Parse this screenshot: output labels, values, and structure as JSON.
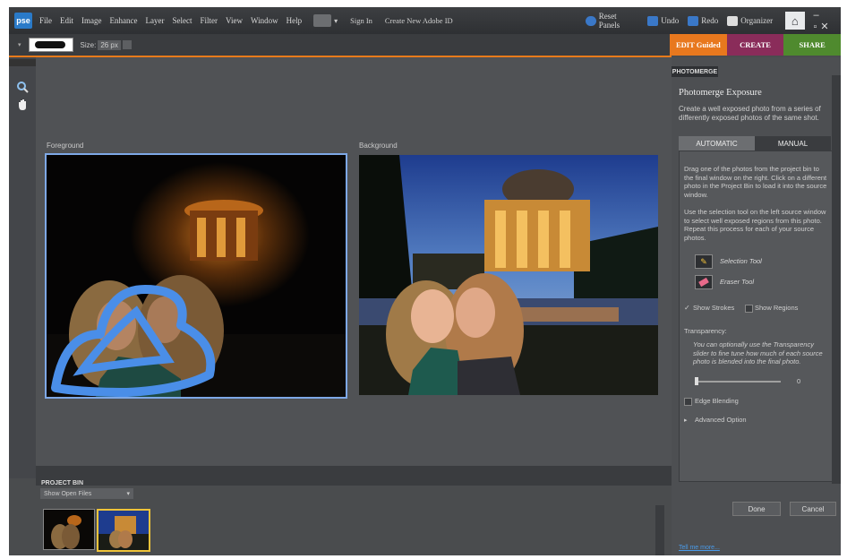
{
  "menubar": {
    "logo": "pse",
    "menus": [
      "File",
      "Edit",
      "Image",
      "Enhance",
      "Layer",
      "Select",
      "Filter",
      "View",
      "Window",
      "Help"
    ],
    "sign_in": "Sign In",
    "create_id": "Create New Adobe ID",
    "reset_panels": "Reset Panels",
    "undo": "Undo",
    "redo": "Redo",
    "organizer": "Organizer"
  },
  "options": {
    "size_label": "Size:",
    "size_value": "26 px"
  },
  "mode_tabs": [
    {
      "label": "EDIT Guided",
      "color": "#e8781e"
    },
    {
      "label": "CREATE",
      "color": "#8a2c5a"
    },
    {
      "label": "SHARE",
      "color": "#4f8a2e"
    }
  ],
  "canvas": {
    "foreground_label": "Foreground",
    "background_label": "Background"
  },
  "project_bin": {
    "title": "PROJECT BIN",
    "select_value": "Show Open Files"
  },
  "panel": {
    "tab": "PHOTOMERGE",
    "title": "Photomerge Exposure",
    "description": "Create a well exposed photo from a series of differently exposed photos of the same shot.",
    "subtab_automatic": "AUTOMATIC",
    "subtab_manual": "MANUAL",
    "instructions_1": "Drag one of the photos from the project bin to the final window on the right. Click on a different photo in the Project Bin to load it into the source window.",
    "instructions_2": "Use the selection tool on the left source window to select well exposed regions from this photo. Repeat this process for each of your source photos.",
    "selection_tool": "Selection Tool",
    "eraser_tool": "Eraser Tool",
    "show_strokes": "Show Strokes",
    "show_regions": "Show Regions",
    "transparency_label": "Transparency:",
    "transparency_help": "You can optionally use the Transparency slider to fine tune how much of each source photo is blended into the final photo.",
    "transparency_value": "0",
    "edge_blending": "Edge Blending",
    "advanced_option": "Advanced Option",
    "done": "Done",
    "cancel": "Cancel",
    "tell_me_more": "Tell me more..."
  }
}
